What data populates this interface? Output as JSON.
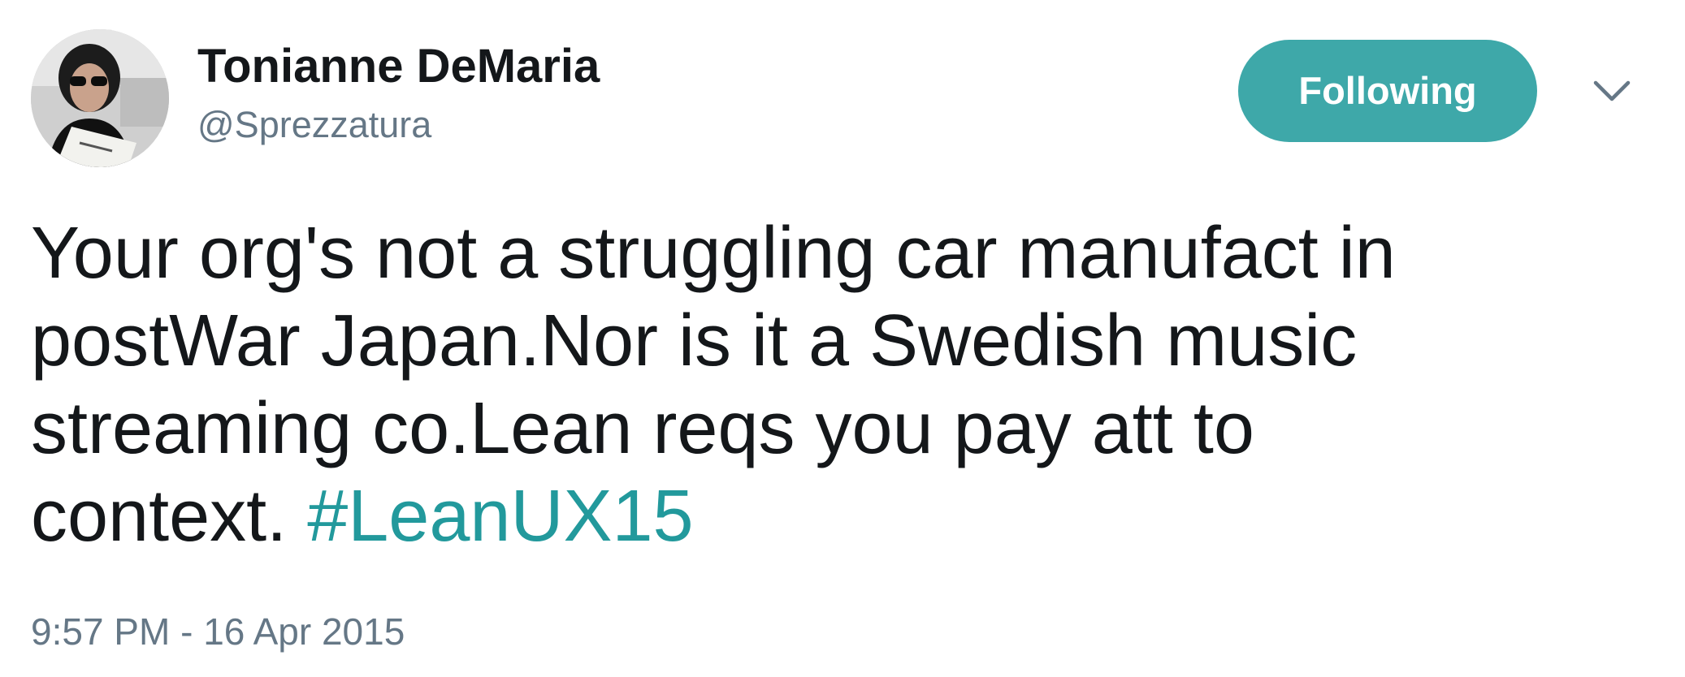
{
  "author": {
    "display_name": "Tonianne DeMaria",
    "handle": "@Sprezzatura",
    "avatar_icon": "profile-photo"
  },
  "follow_button": {
    "label": "Following",
    "color": "#3ea8a9"
  },
  "menu_icon": "chevron-down-icon",
  "tweet": {
    "lines": [
      "Your org's not a struggling car manufact in",
      "postWar Japan.Nor is it a Swedish music",
      "streaming co.Lean reqs you pay att to",
      "context. "
    ],
    "hashtag": "#LeanUX15",
    "hashtag_color": "#22999c",
    "timestamp": "9:57 PM - 16 Apr 2015"
  }
}
